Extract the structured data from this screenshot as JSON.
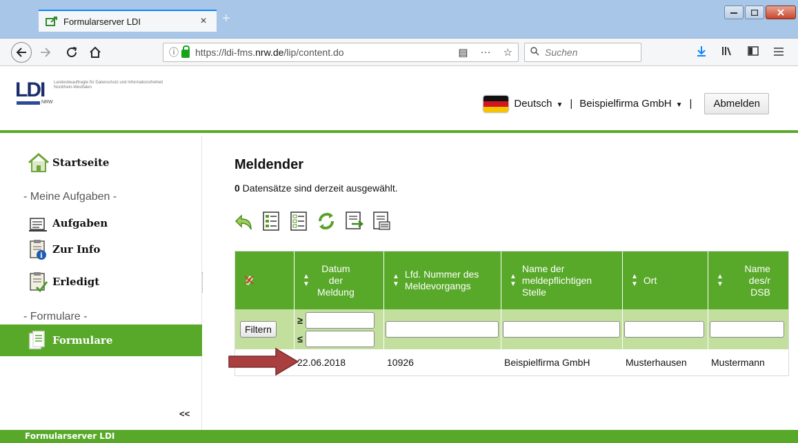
{
  "browser": {
    "tab_title": "Formularserver LDI",
    "tab_close": "×",
    "new_tab": "+",
    "url_pre": "https://ldi-fms.",
    "url_domain": "nrw.de",
    "url_post": "/lip/content.do",
    "search_placeholder": "Suchen",
    "window_controls": [
      "minimize",
      "maximize",
      "close"
    ]
  },
  "app": {
    "logo_text": "LDI",
    "logo_nrw": "NRW",
    "logo_subtitle": "Landesbeauftragte für Datenschutz und Informationsfreiheit Nordrhein-Westfalen",
    "language": "Deutsch",
    "company": "Beispielfirma GmbH",
    "separator": "|",
    "logout": "Abmelden"
  },
  "sidebar": {
    "home": "Startseite",
    "section_tasks": "- Meine Aufgaben -",
    "tasks": "Aufgaben",
    "info": "Zur Info",
    "done": "Erledigt",
    "section_forms": "- Formulare -",
    "forms": "Formulare",
    "collapse": "<<"
  },
  "main": {
    "title": "Meldender",
    "selected_count": "0",
    "selected_text": " Datensätze sind derzeit ausgewählt."
  },
  "table": {
    "columns": [
      "",
      "Datum der Meldung",
      "Lfd. Nummer des Meldevorgangs",
      "Name der meldepflichtigen Stelle",
      "Ort",
      "Name des/r DSB"
    ],
    "filter_button": "Filtern",
    "ge": "≥",
    "le": "≤",
    "rows": [
      [
        "",
        "22.06.2018",
        "10926",
        "Beispielfirma GmbH",
        "Musterhausen",
        "Mustermann"
      ]
    ]
  },
  "footer": {
    "text": "Formularserver LDI"
  },
  "colors": {
    "accent_green": "#58a92a",
    "filter_row": "#c3df9e",
    "arrow": "#a93f3f"
  }
}
